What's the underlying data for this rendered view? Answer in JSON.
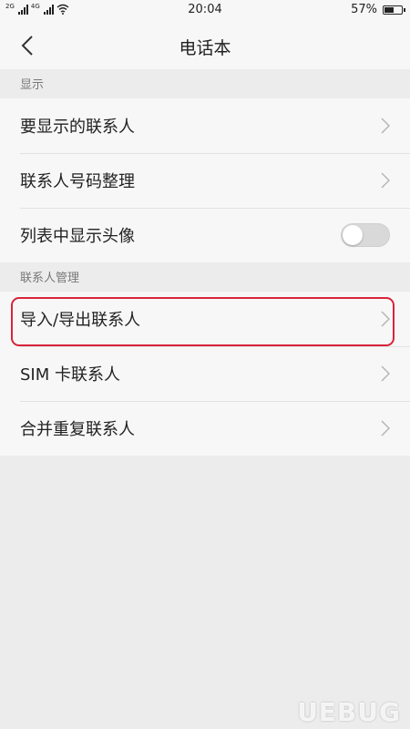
{
  "status_bar": {
    "sim1_label": "2G",
    "sim2_label": "4G",
    "time": "20:04",
    "battery_text": "57%",
    "battery_level": 0.57
  },
  "header": {
    "title": "电话本"
  },
  "sections": {
    "display": {
      "header": "显示",
      "items": [
        "要显示的联系人",
        "联系人号码整理",
        "列表中显示头像"
      ],
      "avatar_toggle_on": false
    },
    "contact_management": {
      "header": "联系人管理",
      "items": [
        "导入/导出联系人",
        "SIM 卡联系人",
        "合并重复联系人"
      ]
    }
  },
  "watermark": "UEBUG",
  "colors": {
    "highlight": "#d8243a",
    "toggle_off": "#d9d9d9"
  }
}
